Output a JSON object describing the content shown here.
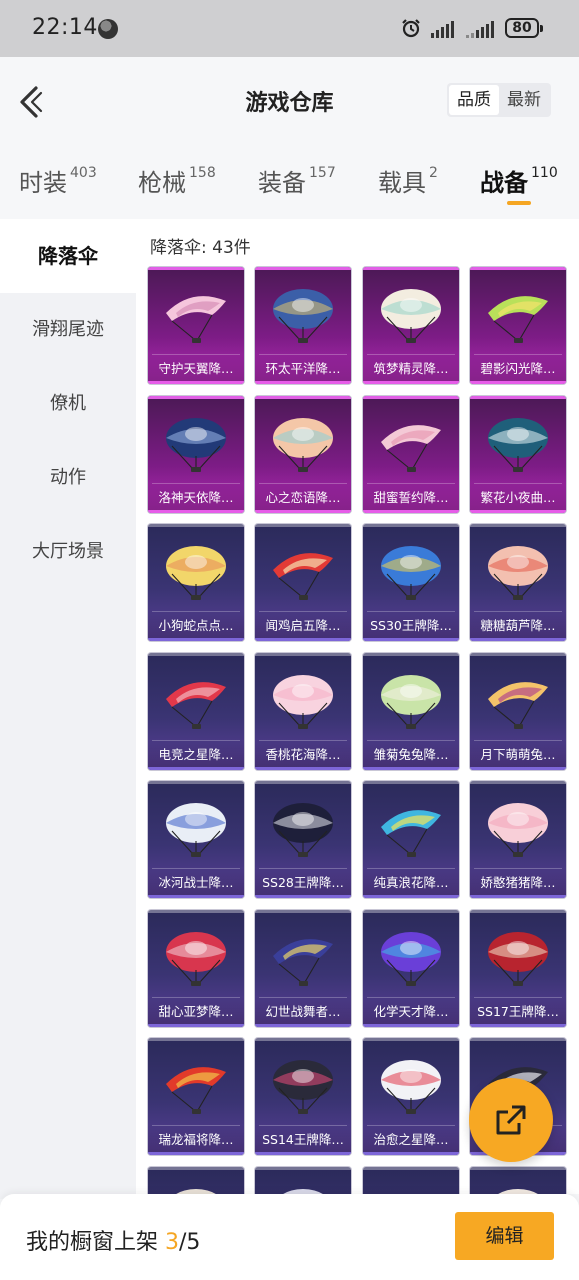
{
  "status_bar": {
    "time": "22:14",
    "battery": "80"
  },
  "header": {
    "title": "游戏仓库",
    "sort_options": [
      "品质",
      "最新"
    ],
    "sort_active": "品质"
  },
  "tabs": [
    {
      "label": "时装",
      "count": "403"
    },
    {
      "label": "枪械",
      "count": "158"
    },
    {
      "label": "装备",
      "count": "157"
    },
    {
      "label": "载具",
      "count": "2"
    },
    {
      "label": "战备",
      "count": "110",
      "active": true
    }
  ],
  "sidebar": {
    "items": [
      {
        "label": "降落伞",
        "active": true
      },
      {
        "label": "滑翔尾迹"
      },
      {
        "label": "僚机"
      },
      {
        "label": "动作"
      },
      {
        "label": "大厅场景"
      }
    ]
  },
  "content": {
    "section_title": "降落伞: 43件",
    "items": [
      {
        "label": "守护天翼降…",
        "tier": "high",
        "colors": [
          "#f5c6dc",
          "#d78fb7"
        ]
      },
      {
        "label": "环太平洋降…",
        "tier": "high",
        "colors": [
          "#3b5fa8",
          "#e2c36b"
        ]
      },
      {
        "label": "筑梦精灵降…",
        "tier": "high",
        "colors": [
          "#f3ede0",
          "#8fd1c7"
        ]
      },
      {
        "label": "碧影闪光降…",
        "tier": "high",
        "colors": [
          "#b9e05a",
          "#f4e36b"
        ]
      },
      {
        "label": "洛神天依降…",
        "tier": "high",
        "colors": [
          "#223a78",
          "#9bb6e8"
        ]
      },
      {
        "label": "心之恋语降…",
        "tier": "high",
        "colors": [
          "#f4c7a8",
          "#8ad0d8"
        ]
      },
      {
        "label": "甜蜜誓约降…",
        "tier": "high",
        "colors": [
          "#f4c9d6",
          "#e89bb4"
        ]
      },
      {
        "label": "繁花小夜曲…",
        "tier": "high",
        "colors": [
          "#1f5f7a",
          "#e8f4f6"
        ]
      },
      {
        "label": "小狗蛇点点…",
        "tier": "normal",
        "colors": [
          "#f2d66a",
          "#e88d5a"
        ]
      },
      {
        "label": "闻鸡启五降…",
        "tier": "normal",
        "colors": [
          "#e23a36",
          "#f6e0b0"
        ]
      },
      {
        "label": "SS30王牌降…",
        "tier": "normal",
        "colors": [
          "#3a7bd8",
          "#f2d34a"
        ]
      },
      {
        "label": "糖糖葫芦降…",
        "tier": "normal",
        "colors": [
          "#f3c0b0",
          "#e25a4a"
        ]
      },
      {
        "label": "电竞之星降…",
        "tier": "normal",
        "colors": [
          "#e2384a",
          "#f4b6bd"
        ]
      },
      {
        "label": "香桃花海降…",
        "tier": "normal",
        "colors": [
          "#f8d3df",
          "#f6aec4"
        ]
      },
      {
        "label": "雏菊兔兔降…",
        "tier": "normal",
        "colors": [
          "#c9e4a8",
          "#f4f1e6"
        ]
      },
      {
        "label": "月下萌萌兔…",
        "tier": "normal",
        "colors": [
          "#f4c36a",
          "#b34a8a"
        ]
      },
      {
        "label": "冰河战士降…",
        "tier": "normal",
        "colors": [
          "#e9eef6",
          "#3a5fc8"
        ]
      },
      {
        "label": "SS28王牌降…",
        "tier": "normal",
        "colors": [
          "#1e1f3a",
          "#e8e8f0"
        ]
      },
      {
        "label": "纯真浪花降…",
        "tier": "normal",
        "colors": [
          "#3fb6e0",
          "#f2e45a"
        ]
      },
      {
        "label": "娇憨猪猪降…",
        "tier": "normal",
        "colors": [
          "#f8cfd8",
          "#f3a4b9"
        ]
      },
      {
        "label": "甜心亚梦降…",
        "tier": "normal",
        "colors": [
          "#d8364e",
          "#f3d2d8"
        ]
      },
      {
        "label": "幻世战舞者…",
        "tier": "normal",
        "colors": [
          "#3a3f9a",
          "#e8d36a"
        ]
      },
      {
        "label": "化学天才降…",
        "tier": "normal",
        "colors": [
          "#6a3fd8",
          "#3ac0e8"
        ]
      },
      {
        "label": "SS17王牌降…",
        "tier": "normal",
        "colors": [
          "#b8242f",
          "#f0e4c8"
        ]
      },
      {
        "label": "瑞龙福将降…",
        "tier": "normal",
        "colors": [
          "#e23a2a",
          "#f2c34a"
        ]
      },
      {
        "label": "SS14王牌降…",
        "tier": "normal",
        "colors": [
          "#2a2a3a",
          "#e84a7a"
        ]
      },
      {
        "label": "治愈之星降…",
        "tier": "normal",
        "colors": [
          "#f2f2f6",
          "#e2384a"
        ]
      },
      {
        "label": "",
        "tier": "normal",
        "colors": [
          "#2a2a3a",
          "#e8e8f0"
        ]
      },
      {
        "label": "",
        "tier": "normal",
        "colors": [
          "#e8e0d6",
          "#c8b8a8"
        ]
      },
      {
        "label": "",
        "tier": "normal",
        "colors": [
          "#d8d8e8",
          "#a8a8c8"
        ]
      },
      {
        "label": "",
        "tier": "normal",
        "colors": [
          "#e8e8f0",
          "#b8b8d0"
        ]
      },
      {
        "label": "",
        "tier": "normal",
        "colors": [
          "#f0e8e0",
          "#c8c0b0"
        ]
      }
    ]
  },
  "bottom_bar": {
    "shelf_label": "我的橱窗上架",
    "shelf_current": "3",
    "shelf_total": "/5",
    "edit_label": "编辑"
  }
}
